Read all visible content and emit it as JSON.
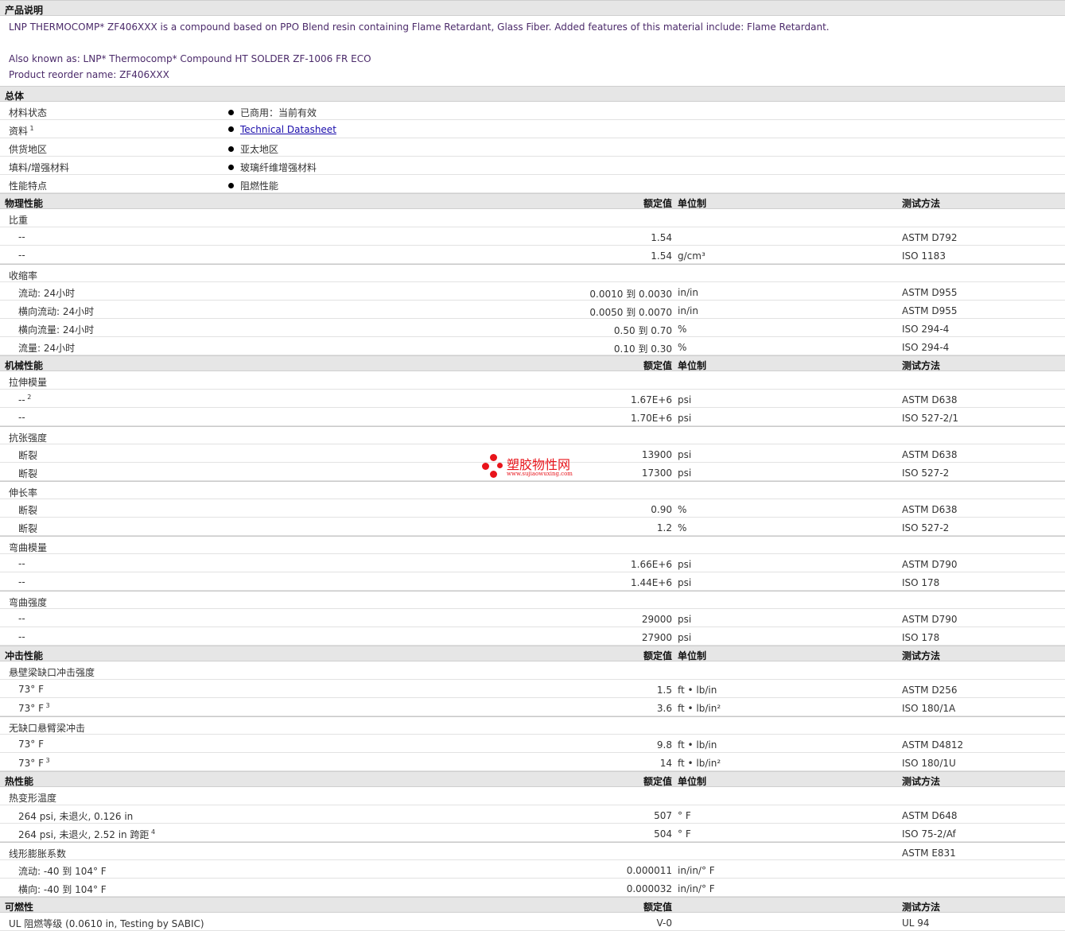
{
  "description": {
    "heading": "产品说明",
    "line1": "LNP THERMOCOMP* ZF406XXX is a compound based on PPO Blend resin containing Flame Retardant, Glass Fiber. Added features of this material include: Flame Retardant.",
    "line2": "Also known as: LNP* Thermocomp* Compound HT SOLDER ZF-1006 FR ECO",
    "line3": "Product reorder name: ZF406XXX"
  },
  "general": {
    "heading": "总体",
    "rows": [
      {
        "label": "材料状态",
        "value": "已商用：当前有效"
      },
      {
        "label": "资料",
        "sup": "1",
        "value": "Technical Datasheet",
        "link": true
      },
      {
        "label": "供货地区",
        "value": "亚太地区"
      },
      {
        "label": "填料/增强材料",
        "value": "玻璃纤维增强材料"
      },
      {
        "label": "性能特点",
        "value": "阻燃性能"
      }
    ]
  },
  "col_headers": {
    "value": "额定值",
    "unit": "单位制",
    "method": "测试方法"
  },
  "sections": [
    {
      "heading": "物理性能",
      "groups": [
        {
          "name": "比重",
          "rows": [
            {
              "label": "--",
              "value": "1.54",
              "unit": "",
              "method": "ASTM D792"
            },
            {
              "label": "--",
              "value": "1.54",
              "unit": "g/cm³",
              "method": "ISO 1183"
            }
          ]
        },
        {
          "name": "收缩率",
          "rows": [
            {
              "label": "流动: 24小时",
              "value": "0.0010 到  0.0030",
              "unit": "in/in",
              "method": "ASTM D955"
            },
            {
              "label": "横向流动: 24小时",
              "value": "0.0050 到  0.0070",
              "unit": "in/in",
              "method": "ASTM D955"
            },
            {
              "label": "横向流量: 24小时",
              "value": "0.50 到  0.70",
              "unit": "%",
              "method": "ISO 294-4"
            },
            {
              "label": "流量: 24小时",
              "value": "0.10 到  0.30",
              "unit": "%",
              "method": "ISO 294-4"
            }
          ]
        }
      ]
    },
    {
      "heading": "机械性能",
      "groups": [
        {
          "name": "拉伸模量",
          "rows": [
            {
              "label": "--",
              "sup": "2",
              "value": "1.67E+6",
              "unit": "psi",
              "method": "ASTM D638"
            },
            {
              "label": "--",
              "value": "1.70E+6",
              "unit": "psi",
              "method": "ISO 527-2/1"
            }
          ]
        },
        {
          "name": "抗张强度",
          "rows": [
            {
              "label": "断裂",
              "value": "13900",
              "unit": "psi",
              "method": "ASTM D638"
            },
            {
              "label": "断裂",
              "value": "17300",
              "unit": "psi",
              "method": "ISO 527-2"
            }
          ]
        },
        {
          "name": "伸长率",
          "rows": [
            {
              "label": "断裂",
              "value": "0.90",
              "unit": "%",
              "method": "ASTM D638"
            },
            {
              "label": "断裂",
              "value": "1.2",
              "unit": "%",
              "method": "ISO 527-2"
            }
          ]
        },
        {
          "name": "弯曲模量",
          "rows": [
            {
              "label": "--",
              "value": "1.66E+6",
              "unit": "psi",
              "method": "ASTM D790"
            },
            {
              "label": "--",
              "value": "1.44E+6",
              "unit": "psi",
              "method": "ISO 178"
            }
          ]
        },
        {
          "name": "弯曲强度",
          "rows": [
            {
              "label": "--",
              "value": "29000",
              "unit": "psi",
              "method": "ASTM D790"
            },
            {
              "label": "--",
              "value": "27900",
              "unit": "psi",
              "method": "ISO 178"
            }
          ]
        }
      ]
    },
    {
      "heading": "冲击性能",
      "groups": [
        {
          "name": "悬壁梁缺口冲击强度",
          "rows": [
            {
              "label": "73° F",
              "value": "1.5",
              "unit": "ft • lb/in",
              "method": "ASTM D256"
            },
            {
              "label": "73° F",
              "sup": "3",
              "value": "3.6",
              "unit": "ft • lb/in²",
              "method": "ISO 180/1A"
            }
          ]
        },
        {
          "name": "无缺口悬臂梁冲击",
          "rows": [
            {
              "label": "73° F",
              "value": "9.8",
              "unit": "ft • lb/in",
              "method": "ASTM D4812"
            },
            {
              "label": "73° F",
              "sup": "3",
              "value": "14",
              "unit": "ft • lb/in²",
              "method": "ISO 180/1U"
            }
          ]
        }
      ]
    },
    {
      "heading": "热性能",
      "groups": [
        {
          "name": "热变形温度",
          "rows": [
            {
              "label": "264 psi, 未退火, 0.126 in",
              "value": "507",
              "unit": "° F",
              "method": "ASTM D648"
            },
            {
              "label": "264 psi, 未退火, 2.52 in 跨距",
              "sup": "4",
              "value": "504",
              "unit": "° F",
              "method": "ISO 75-2/Af"
            }
          ]
        },
        {
          "name": "线形膨胀系数",
          "method": "ASTM E831",
          "rows": [
            {
              "label": "流动: -40 到  104° F",
              "value": "0.000011",
              "unit": "in/in/° F",
              "method": ""
            },
            {
              "label": "横向: -40 到  104° F",
              "value": "0.000032",
              "unit": "in/in/° F",
              "method": ""
            }
          ]
        }
      ]
    }
  ],
  "flammability": {
    "heading": "可燃性",
    "value_header": "额定值",
    "method_header": "测试方法",
    "row": {
      "label": "UL 阻燃等级  (0.0610 in, Testing by SABIC)",
      "value": "V-0",
      "method": "UL 94"
    }
  },
  "watermark": {
    "cn": "塑胶物性网",
    "en": "www.sujiaowuxing.com",
    "color": "#e8141b"
  }
}
